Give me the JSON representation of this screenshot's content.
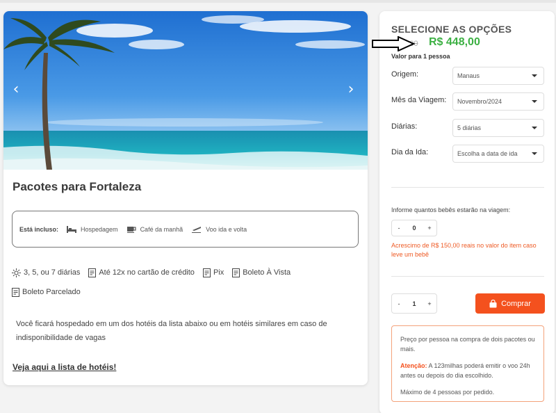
{
  "hero": {
    "prev_icon": "chevron-left-icon",
    "next_icon": "chevron-right-icon"
  },
  "package": {
    "title": "Pacotes para Fortaleza",
    "included_label": "Está incluso:",
    "included": [
      {
        "icon": "bed-icon",
        "label": "Hospedagem"
      },
      {
        "icon": "coffee-cup-icon",
        "label": "Café da manhã"
      },
      {
        "icon": "airplane-takeoff-icon",
        "label": "Voo ida e volta"
      }
    ],
    "features": [
      {
        "icon": "sun-icon",
        "label": "3, 5, ou 7 diárias"
      },
      {
        "icon": "receipt-icon",
        "label": "Até 12x no cartão de crédito"
      },
      {
        "icon": "receipt-icon",
        "label": "Pix"
      },
      {
        "icon": "receipt-icon",
        "label": "Boleto À Vista"
      },
      {
        "icon": "receipt-icon",
        "label": "Boleto Parcelado"
      }
    ],
    "description": "Você ficará hospedado em um dos hotéis da lista abaixo ou em hotéis similares em caso de indisponibilidade de vagas",
    "hotels_link": "Veja aqui a lista de hotéis!"
  },
  "options": {
    "title": "SELECIONE AS OPÇÕES",
    "old_price": "R$ 0,00",
    "price": "R$ 448,00",
    "price_note": "Valor para 1 pessoa",
    "fields": [
      {
        "label": "Origem:",
        "value": "Manaus"
      },
      {
        "label": "Mês da Viagem:",
        "value": "Novembro/2024"
      },
      {
        "label": "Diárias:",
        "value": "5 diárias"
      },
      {
        "label": "Dia da Ida:",
        "value": "Escolha a data de ida"
      }
    ],
    "babies_label": "Informe quantos bebês estarão na viagem:",
    "babies_count": "0",
    "babies_note": "Acrescimo de R$ 150,00 reais no valor do item caso leve um bebê",
    "quantity": "1",
    "minus": "-",
    "plus": "+",
    "buy_label": "Comprar",
    "notice_text": "Preço por pessoa na compra de dois pacotes ou mais.",
    "attention_label": "Atenção:",
    "attention_text": " A 123milhas poderá emitir o voo 24h antes ou depois do dia escolhido.",
    "max_text": "Máximo de 4 pessoas por pedido."
  },
  "colors": {
    "price_green": "#3cb043",
    "accent_orange": "#f4511e"
  }
}
